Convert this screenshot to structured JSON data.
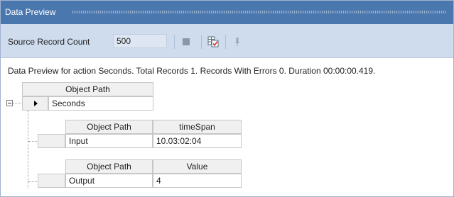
{
  "panel": {
    "title": "Data Preview"
  },
  "toolbar": {
    "source_label": "Source Record Count",
    "source_value": "500",
    "icons": [
      "stop-icon",
      "preview-grid-icon",
      "pin-icon"
    ]
  },
  "status": {
    "text": "Data Preview for action Seconds. Total Records 1. Records With Errors 0. Duration 00:00:00.419."
  },
  "grid": {
    "root": {
      "header": "Object Path",
      "row_value": "Seconds",
      "expanded": true
    },
    "children": [
      {
        "headers": [
          "Object Path",
          "timeSpan"
        ],
        "row": [
          "Input",
          "10.03:02:04"
        ]
      },
      {
        "headers": [
          "Object Path",
          "Value"
        ],
        "row": [
          "Output",
          "4"
        ]
      }
    ]
  },
  "colors": {
    "title_bar": "#4a77ad",
    "toolbar_bg": "#cfdcee",
    "header_bg": "#f0f0f0",
    "grid_border": "#c6c6c6"
  }
}
